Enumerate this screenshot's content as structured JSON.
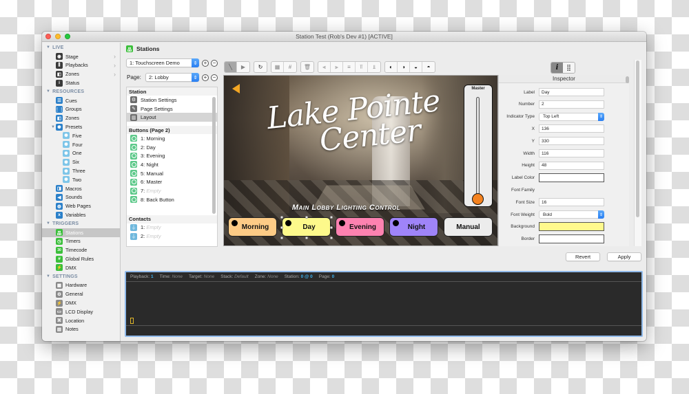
{
  "window": {
    "title": "Station Test (Rob's Dev #1) [ACTIVE]"
  },
  "sidebar": {
    "sections": [
      {
        "label": "LIVE",
        "items": [
          {
            "label": "Stage",
            "icon": "eye-icon",
            "chevron": true
          },
          {
            "label": "Playbacks",
            "icon": "playbacks-icon",
            "chevron": true
          },
          {
            "label": "Zones",
            "icon": "zones-icon",
            "chevron": true
          },
          {
            "label": "Status",
            "icon": "info-icon",
            "chevron": false
          }
        ]
      },
      {
        "label": "RESOURCES",
        "items": [
          {
            "label": "Cues",
            "icon": "list-icon"
          },
          {
            "label": "Groups",
            "icon": "grid-icon"
          },
          {
            "label": "Zones",
            "icon": "zones-icon"
          },
          {
            "label": "Presets",
            "icon": "preset-icon",
            "expanded": true
          },
          {
            "label": "Five",
            "icon": "preset-sun-icon",
            "sub": true
          },
          {
            "label": "Four",
            "icon": "preset-sun-icon",
            "sub": true
          },
          {
            "label": "One",
            "icon": "preset-sun-icon",
            "sub": true
          },
          {
            "label": "Six",
            "icon": "preset-sun-icon",
            "sub": true
          },
          {
            "label": "Three",
            "icon": "preset-sun-icon",
            "sub": true
          },
          {
            "label": "Two",
            "icon": "preset-sun-icon",
            "sub": true
          },
          {
            "label": "Macros",
            "icon": "macro-icon"
          },
          {
            "label": "Sounds",
            "icon": "speaker-icon"
          },
          {
            "label": "Web Pages",
            "icon": "globe-icon"
          },
          {
            "label": "Variables",
            "icon": "variable-icon"
          }
        ]
      },
      {
        "label": "TRIGGERS",
        "items": [
          {
            "label": "Stations",
            "icon": "stations-icon",
            "selected": true
          },
          {
            "label": "Timers",
            "icon": "timer-icon"
          },
          {
            "label": "Timecode",
            "icon": "timecode-icon"
          },
          {
            "label": "Global Rules",
            "icon": "hash-icon"
          },
          {
            "label": "DMX",
            "icon": "dmx-icon"
          }
        ]
      },
      {
        "label": "SETTINGS",
        "items": [
          {
            "label": "Hardware",
            "icon": "hardware-icon"
          },
          {
            "label": "General",
            "icon": "gear-icon"
          },
          {
            "label": "DMX",
            "icon": "dmx-icon"
          },
          {
            "label": "LCD Display",
            "icon": "lcd-icon"
          },
          {
            "label": "Location",
            "icon": "location-icon"
          },
          {
            "label": "Notes",
            "icon": "notes-icon"
          }
        ]
      }
    ]
  },
  "main": {
    "header": "Stations",
    "station_select": "1: Touchscreen Demo",
    "page_label": "Page:",
    "page_select": "2: Lobby",
    "station_list": {
      "station_header": "Station",
      "station_items": [
        {
          "label": "Station Settings",
          "icon": "gear-icon"
        },
        {
          "label": "Page Settings",
          "icon": "pencil-icon"
        },
        {
          "label": "Layout",
          "icon": "layout-icon",
          "selected": true
        }
      ],
      "buttons_header": "Buttons (Page 2)",
      "buttons": [
        {
          "num": "1:",
          "label": "Morning",
          "empty": false
        },
        {
          "num": "2:",
          "label": "Day",
          "empty": false
        },
        {
          "num": "3:",
          "label": "Evening",
          "empty": false
        },
        {
          "num": "4:",
          "label": "Night",
          "empty": false
        },
        {
          "num": "5:",
          "label": "Manual",
          "empty": false
        },
        {
          "num": "6:",
          "label": "Master",
          "empty": false
        },
        {
          "num": "7:",
          "label": "Empty",
          "empty": true
        },
        {
          "num": "8:",
          "label": "Back Button",
          "empty": false
        }
      ],
      "contacts_header": "Contacts",
      "contacts": [
        {
          "num": "1:",
          "label": "Empty"
        },
        {
          "num": "2:",
          "label": "Empty"
        }
      ]
    },
    "canvas": {
      "title_line1": "Lake Pointe",
      "title_line2": "Center",
      "subtitle": "Main Lobby Lighting Control",
      "master_label": "Master",
      "master_level": 0.0,
      "buttons": [
        {
          "label": "Morning",
          "color": "#fdcb86",
          "indicator": true
        },
        {
          "label": "Day",
          "color": "#fdf98b",
          "indicator": true,
          "selected": true
        },
        {
          "label": "Evening",
          "color": "#fd82b0",
          "indicator": true
        },
        {
          "label": "Night",
          "color": "#9f84f9",
          "indicator": true
        },
        {
          "label": "Manual",
          "color": "#ececec",
          "indicator": false
        }
      ]
    },
    "inspector": {
      "title": "Inspector",
      "fields": {
        "label": {
          "name": "Label",
          "value": "Day"
        },
        "number": {
          "name": "Number",
          "value": "2"
        },
        "indicator_type": {
          "name": "Indicator Type",
          "value": "Top Left"
        },
        "x": {
          "name": "X",
          "value": "136"
        },
        "y": {
          "name": "Y",
          "value": "330"
        },
        "width": {
          "name": "Width",
          "value": "116"
        },
        "height": {
          "name": "Height",
          "value": "48"
        },
        "label_color": {
          "name": "Label Color",
          "value": "#ffffff"
        },
        "font_family": {
          "name": "Font Family",
          "value": ""
        },
        "font_size": {
          "name": "Font Size",
          "value": "16"
        },
        "font_weight": {
          "name": "Font Weight",
          "value": "Bold"
        },
        "background": {
          "name": "Background",
          "value": "#fff98d"
        },
        "border": {
          "name": "Border",
          "value": "#ffffff"
        }
      }
    },
    "revert_label": "Revert",
    "apply_label": "Apply"
  },
  "console": {
    "playback_key": "Playback:",
    "playback_val": "1",
    "time_key": "Time:",
    "time_val": "None",
    "target_key": "Target:",
    "target_val": "None",
    "stack_key": "Stack:",
    "stack_val": "Default",
    "zone_key": "Zone:",
    "zone_val": "None",
    "station_key": "Station:",
    "station_val": "0 @ 0",
    "page_key": "Page:",
    "page_val": "0"
  }
}
